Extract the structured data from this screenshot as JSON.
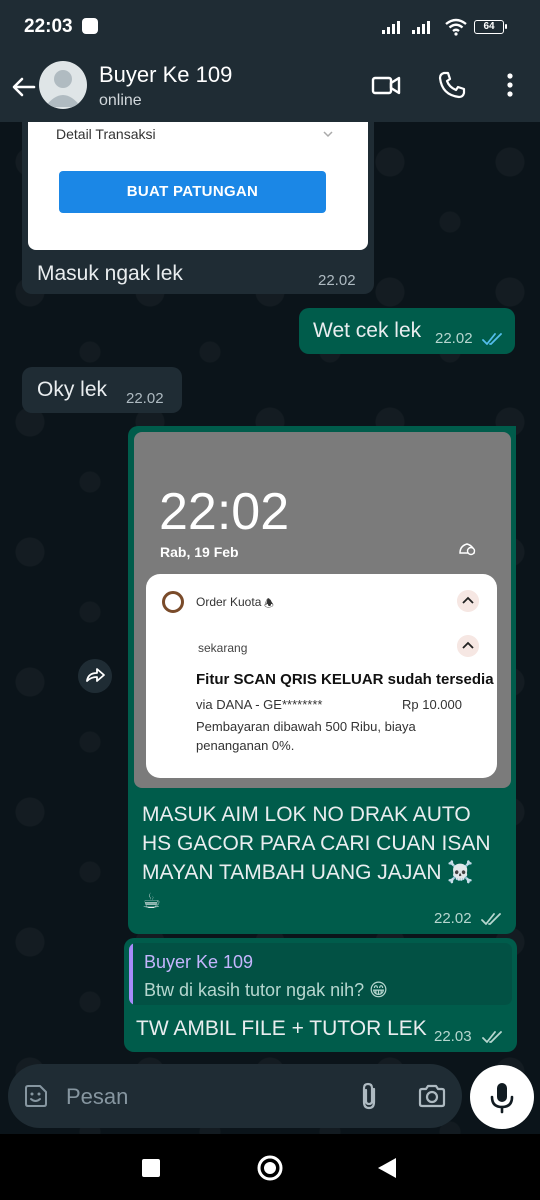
{
  "status": {
    "time": "22:03",
    "battery": "64"
  },
  "header": {
    "name": "Buyer Ke 109",
    "status": "online"
  },
  "messages": {
    "m1": {
      "image": {
        "title": "Detail Transaksi",
        "button": "BUAT PATUNGAN"
      },
      "text": "Masuk ngak lek",
      "time": "22.02"
    },
    "m2": {
      "text": "Wet cek lek",
      "time": "22.02"
    },
    "m3": {
      "text": "Oky lek",
      "time": "22.02"
    },
    "m4": {
      "image": {
        "lock_time": "22:02",
        "lock_date": "Rab, 19 Feb",
        "app": "Order Kuota",
        "when": "sekarang",
        "title": "Fitur SCAN QRIS KELUAR sudah tersedia",
        "via": "via DANA - GE********",
        "amount": "Rp 10.000",
        "desc": "Pembayaran dibawah 500 Ribu, biaya penanganan 0%."
      },
      "line1": "MASUK AIM LOK NO DRAK AUTO",
      "line2": "HS GACOR PARA CARI CUAN ISAN",
      "line3": "MAYAN TAMBAH UANG JAJAN ☠️",
      "line4": "☕",
      "time": "22.02"
    },
    "m5": {
      "quote_name": "Buyer Ke 109",
      "quote_text": "Btw di kasih tutor ngak nih? 😁",
      "text": "TW AMBIL FILE + TUTOR LEK",
      "time": "22.03"
    }
  },
  "input": {
    "placeholder": "Pesan"
  },
  "icons": [
    "back-arrow-icon",
    "video-call-icon",
    "phone-icon",
    "more-icon",
    "forward-icon",
    "emoji-icon",
    "attach-icon",
    "camera-icon",
    "mic-icon"
  ],
  "colors": {
    "header": "#1f2c34",
    "incoming": "#1f2c34",
    "outgoing": "#005c4b",
    "read_tick": "#53bdeb"
  }
}
